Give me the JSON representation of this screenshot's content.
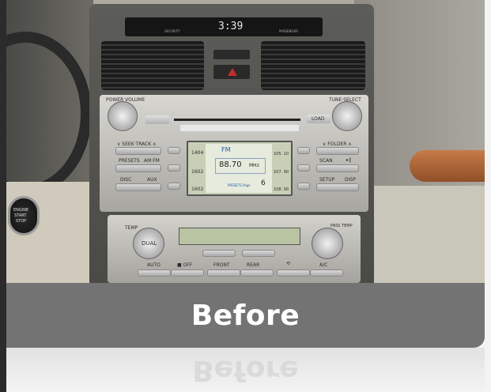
{
  "caption": "Before",
  "reflection_caption": "Before",
  "clock": {
    "time": "3:39",
    "left_label": "SECURITY",
    "right_label": "PASSENGER"
  },
  "audio": {
    "power_volume_label": "POWER VOLUME",
    "tune_select_label": "TUNE·SELECT",
    "load_label": "LOAD",
    "seek_track_label": "∨ SEEK·TRACK ∧",
    "presets_label": "PRESETS",
    "am_fm_label": "AM·FM",
    "disc_label": "DISC",
    "aux_label": "AUX",
    "folder_label": "∨ FOLDER ∧",
    "scan_label": "SCAN",
    "scan_symbol": "▸∥",
    "setup_label": "SETUP",
    "disp_label": "DISP",
    "screen": {
      "band": "FM",
      "frequency": "88.70",
      "unit": "MHz",
      "presets_page_label": "PRESETS Page",
      "presets_page_number": "6",
      "left_presets": [
        "1404",
        "1602",
        "1602"
      ],
      "right_presets": [
        "105. 10",
        "107. 90",
        "108. 00"
      ]
    }
  },
  "climate": {
    "dual_label": "DUAL",
    "temp_label": "TEMP",
    "pass_temp_label": "PASS TEMP",
    "auto_label": "AUTO",
    "off_label": "■ OFF",
    "front_label": "FRONT",
    "rear_label": "REAR",
    "recirc_label": "⟲",
    "ac_label": "A/C"
  },
  "start_button": {
    "line1": "ENGINE",
    "line2": "START",
    "line3": "STOP"
  },
  "colors": {
    "caption_band": "#737373",
    "wood_trim": "#b0683a",
    "lcd_green": "#c7d0b6",
    "hazard_red": "#c0302a"
  }
}
